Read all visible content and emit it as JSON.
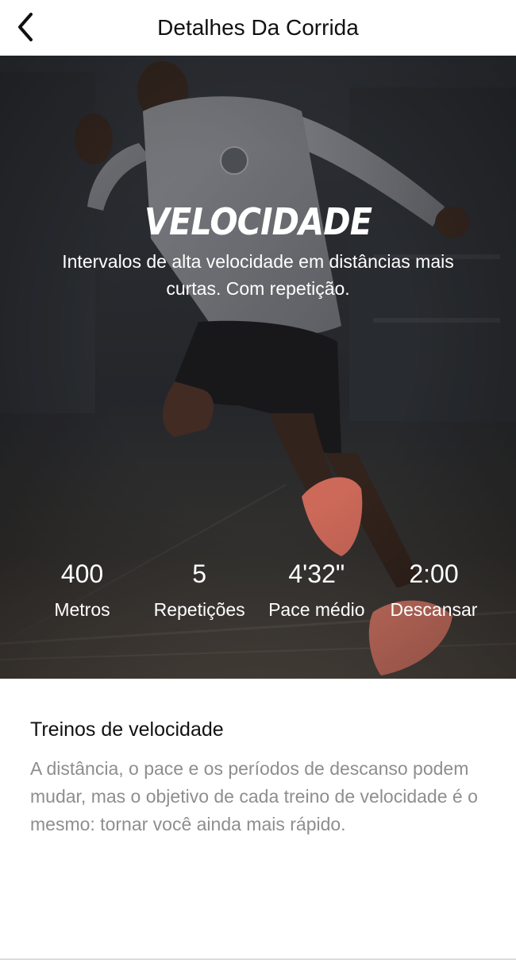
{
  "header": {
    "title": "Detalhes Da Corrida",
    "back_icon": "chevron-left-icon"
  },
  "hero": {
    "title": "VELOCIDADE",
    "subtitle": "Intervalos de alta velocidade em distâncias mais curtas. Com repetição.",
    "stats": [
      {
        "value": "400",
        "label": "Metros"
      },
      {
        "value": "5",
        "label": "Repetições"
      },
      {
        "value": "4'32\"",
        "label": "Pace médio"
      },
      {
        "value": "2:00",
        "label": "Descansar"
      }
    ]
  },
  "description": {
    "title": "Treinos de velocidade",
    "body": "A distância, o pace e os períodos de descanso podem mudar, mas o objetivo de cada treino de velocidade é o mesmo: tornar você ainda mais rápido."
  },
  "colors": {
    "accent_shoe": "#f07a6a",
    "hero_overlay": "#2c2e33",
    "body_text": "#8e8e8e"
  }
}
